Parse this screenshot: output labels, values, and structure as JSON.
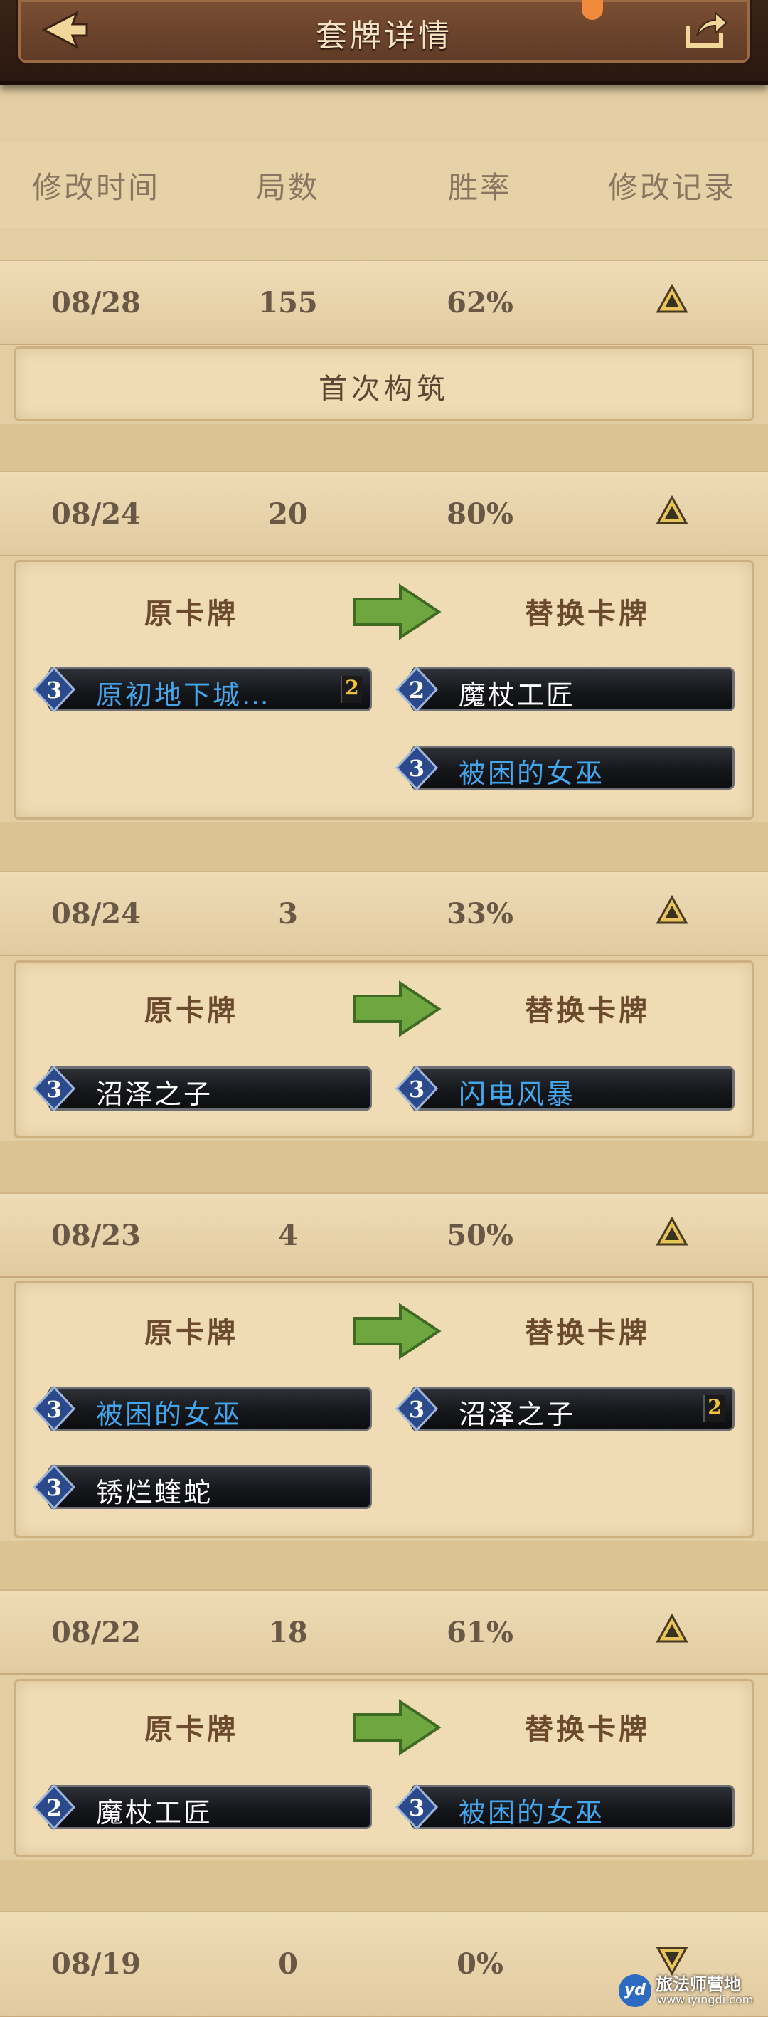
{
  "header": {
    "title": "套牌详情"
  },
  "columns": [
    "修改时间",
    "局数",
    "胜率",
    "修改记录"
  ],
  "labels": {
    "first_build": "首次构筑",
    "original": "原卡牌",
    "replacement": "替换卡牌"
  },
  "colors": {
    "blue_name": "#43a6ec",
    "white_name": "#ffffff",
    "arrow_green": "#6ea640"
  },
  "records": [
    {
      "date": "08/28",
      "games": "155",
      "winrate": "62%",
      "toggle": "expanded"
    },
    {
      "date": "08/24",
      "games": "20",
      "winrate": "80%",
      "toggle": "expanded",
      "original": [
        {
          "cost": "3",
          "name": "原初地下城…",
          "count": "2",
          "color": "blue"
        }
      ],
      "replacement": [
        {
          "cost": "2",
          "name": "魔杖工匠",
          "color": "white"
        },
        {
          "cost": "3",
          "name": "被困的女巫",
          "color": "blue"
        }
      ]
    },
    {
      "date": "08/24",
      "games": "3",
      "winrate": "33%",
      "toggle": "expanded",
      "original": [
        {
          "cost": "3",
          "name": "沼泽之子",
          "color": "white"
        }
      ],
      "replacement": [
        {
          "cost": "3",
          "name": "闪电风暴",
          "color": "blue"
        }
      ]
    },
    {
      "date": "08/23",
      "games": "4",
      "winrate": "50%",
      "toggle": "expanded",
      "original": [
        {
          "cost": "3",
          "name": "被困的女巫",
          "color": "blue"
        },
        {
          "cost": "3",
          "name": "锈烂蝰蛇",
          "color": "white"
        }
      ],
      "replacement": [
        {
          "cost": "3",
          "name": "沼泽之子",
          "count": "2",
          "color": "white"
        }
      ]
    },
    {
      "date": "08/22",
      "games": "18",
      "winrate": "61%",
      "toggle": "expanded",
      "original": [
        {
          "cost": "2",
          "name": "魔杖工匠",
          "color": "white"
        }
      ],
      "replacement": [
        {
          "cost": "3",
          "name": "被困的女巫",
          "color": "blue"
        }
      ]
    },
    {
      "date": "08/19",
      "games": "0",
      "winrate": "0%",
      "toggle": "collapsed"
    }
  ],
  "watermark": {
    "name": "旅法师营地",
    "url": "www.iyingdi.com",
    "logo": "yd"
  }
}
